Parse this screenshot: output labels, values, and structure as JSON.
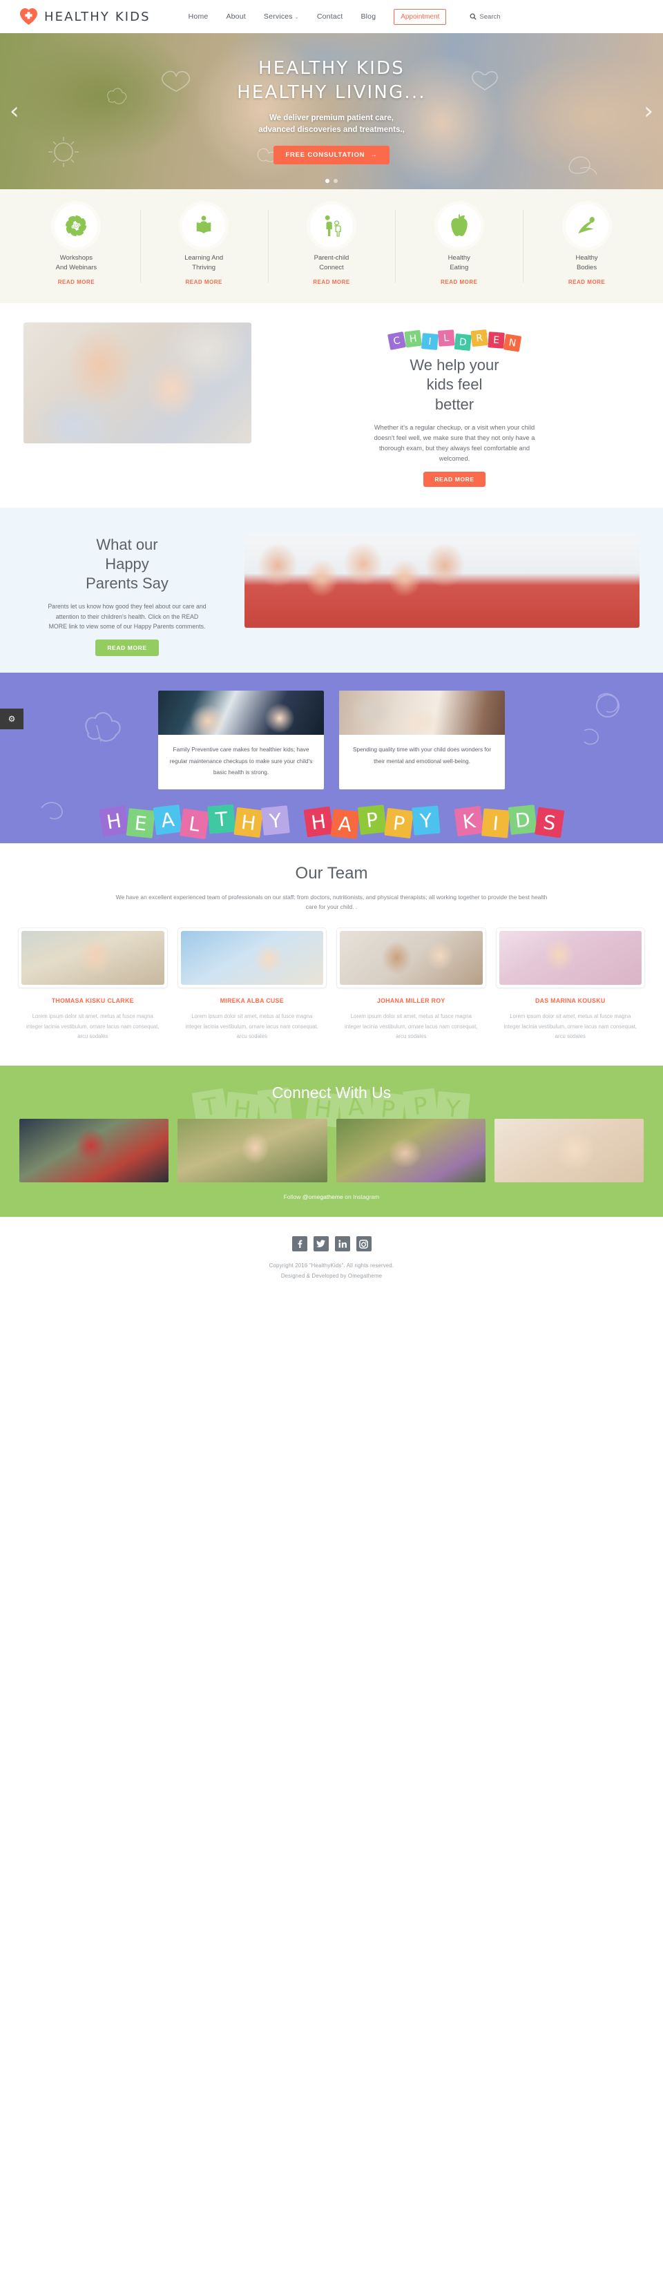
{
  "header": {
    "brand": "HEALTHY KIDS",
    "logo_icon": "heart-plus-icon",
    "nav": [
      {
        "label": "Home"
      },
      {
        "label": "About"
      },
      {
        "label": "Services",
        "caret": "⌄"
      },
      {
        "label": "Contact"
      },
      {
        "label": "Blog"
      }
    ],
    "appointment_label": "Appointment",
    "search_label": "Search",
    "search_icon": "search-icon"
  },
  "hero": {
    "title_line1": "HEALTHY KIDS",
    "title_line2": "HEALTHY LIVING...",
    "subtitle_line1": "We deliver premium patient care,",
    "subtitle_line2": "advanced discoveries and treatments.,",
    "cta_label": "FREE CONSULTATION",
    "cta_arrow": "→",
    "prev_icon": "chevron-left-icon",
    "next_icon": "chevron-right-icon",
    "prev_glyph": "‹",
    "next_glyph": "›",
    "slides": 2,
    "active_slide": 0
  },
  "features": {
    "read_more": "READ MORE",
    "items": [
      {
        "title_line1": "Workshops",
        "title_line2": "And Webinars",
        "icon": "kids-pinwheel-icon"
      },
      {
        "title_line1": "Learning And",
        "title_line2": "Thriving",
        "icon": "open-book-reader-icon"
      },
      {
        "title_line1": "Parent-child",
        "title_line2": "Connect",
        "icon": "parent-child-icon"
      },
      {
        "title_line1": "Healthy",
        "title_line2": "Eating",
        "icon": "apple-icon"
      },
      {
        "title_line1": "Healthy",
        "title_line2": "Bodies",
        "icon": "running-person-icon"
      }
    ]
  },
  "help": {
    "word_letters": [
      "C",
      "H",
      "I",
      "L",
      "D",
      "R",
      "E",
      "N"
    ],
    "word_colors": [
      "#9b6fd6",
      "#7fd37f",
      "#4cc3ef",
      "#e86fa8",
      "#3fc9a2",
      "#f2b83a",
      "#e83c5e",
      "#f9693f"
    ],
    "heading_line1": "We help your",
    "heading_line2": "kids feel",
    "heading_line3": "better",
    "paragraph": "Whether it's a regular checkup, or a visit when your child doesn't feel well, we make sure that they not only have a thorough exam, but they always feel comfortable and welcomed.",
    "button_label": "READ MORE",
    "photo_alt": "family-with-baby-photo"
  },
  "parents": {
    "heading_line1": "What our",
    "heading_line2": "Happy",
    "heading_line3": "Parents Say",
    "paragraph": "Parents let us know how good they feel about our care and attention to their children's health. Click on the READ MORE link to view some of our Happy Parents comments.",
    "button_label": "READ MORE",
    "photo_alt": "family-in-red-shirts-photo"
  },
  "testimonials": {
    "side_tab_icon": "gear-icon",
    "side_tab_glyph": "⚙",
    "cards": [
      {
        "text": "Family Preventive care makes for healthier kids; have regular maintenance checkups to make sure your child's basic health is strong.",
        "photo_alt": "mother-and-children-photo"
      },
      {
        "text": "Spending quality time with your child does wonders for their mental and emotional well-being.",
        "photo_alt": "parents-with-baby-photo"
      }
    ],
    "banner_word1": [
      "H",
      "E",
      "A",
      "L",
      "T",
      "H",
      "Y"
    ],
    "banner_word2": [
      "H",
      "A",
      "P",
      "P",
      "Y"
    ],
    "banner_word3": [
      "K",
      "I",
      "D",
      "S"
    ],
    "banner_colors_1": [
      "#9b6fd6",
      "#7fd37f",
      "#4cc3ef",
      "#e86fa8",
      "#3fc9a2",
      "#f2b83a",
      "#b9a8e8"
    ],
    "banner_colors_2": [
      "#e83c5e",
      "#f9693f",
      "#8fc93a",
      "#f2b83a",
      "#4cc3ef"
    ],
    "banner_colors_3": [
      "#e86fa8",
      "#f2b83a",
      "#7fd37f",
      "#e83c5e"
    ]
  },
  "team": {
    "heading": "Our Team",
    "paragraph": "We have an excellent experienced team of professionals on our staff: from doctors, nutritionists, and physical therapists; all working together to provide the best health care for your child. .",
    "members": [
      {
        "name": "THOMASA KISKU CLARKE",
        "bio": "Lorem ipsum dolor sit amet, metus at fusce magna integer lacinia vestibulum, ornare lacus nam consequat, arcu sodales",
        "photo_alt": "team-member-photo-1"
      },
      {
        "name": "MIREKA ALBA CUSE",
        "bio": "Lorem ipsum dolor sit amet, metus at fusce magna integer lacinia vestibulum, ornare lacus nam consequat, arcu sodales",
        "photo_alt": "team-member-photo-2"
      },
      {
        "name": "JOHANA MILLER ROY",
        "bio": "Lorem ipsum dolor sit amet, metus at fusce magna integer lacinia vestibulum, ornare lacus nam consequat, arcu sodales",
        "photo_alt": "team-member-photo-3"
      },
      {
        "name": "DAS MARINA KOUSKU",
        "bio": "Lorem ipsum dolor sit amet, metus at fusce magna integer lacinia vestibulum, ornare lacus nam consequat, arcu sodales",
        "photo_alt": "team-member-photo-4"
      }
    ]
  },
  "connect": {
    "heading": "Connect With Us",
    "ghost_letters": [
      "T",
      "H",
      "Y",
      "H",
      "A",
      "P",
      "P",
      "Y"
    ],
    "follow_prefix": "Follow ",
    "follow_handle": "@omegatheme",
    "follow_suffix": " on Instagram",
    "photos": [
      "instagram-photo-1",
      "instagram-photo-2",
      "instagram-photo-3",
      "instagram-photo-4"
    ]
  },
  "footer": {
    "social": [
      {
        "name": "facebook-icon",
        "glyph": "f"
      },
      {
        "name": "twitter-icon",
        "glyph": "🐦"
      },
      {
        "name": "linkedin-icon",
        "glyph": "in"
      },
      {
        "name": "instagram-icon",
        "glyph": "◎"
      }
    ],
    "copyright": "Copyright 2016 \"HealthyKids\". All rights reserved.",
    "credit": "Designed & Developed by Omegatheme"
  },
  "colors": {
    "coral": "#fb6a4a",
    "green": "#93cc5f",
    "purple": "#8183d8",
    "connect_green": "#9bcc68",
    "cream": "#f7f6ef",
    "pale_blue": "#eef5fb"
  }
}
